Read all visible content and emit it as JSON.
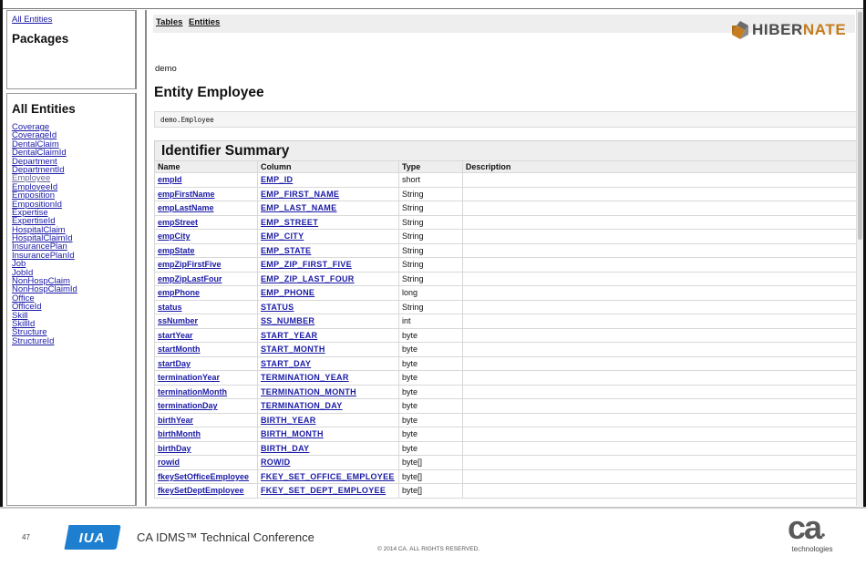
{
  "left_top": {
    "all_entities_link": "All Entities",
    "packages_title": "Packages"
  },
  "left_bottom": {
    "title": "All Entities",
    "items": [
      {
        "label": "Coverage",
        "current": false
      },
      {
        "label": "CoverageId",
        "current": false
      },
      {
        "label": "DentalClaim",
        "current": false
      },
      {
        "label": "DentalClaimId",
        "current": false
      },
      {
        "label": "Department",
        "current": false
      },
      {
        "label": "DepartmentId",
        "current": false
      },
      {
        "label": "Employee",
        "current": true
      },
      {
        "label": "EmployeeId",
        "current": false
      },
      {
        "label": "Emposition",
        "current": false
      },
      {
        "label": "EmpositionId",
        "current": false
      },
      {
        "label": "Expertise",
        "current": false
      },
      {
        "label": "ExpertiseId",
        "current": false
      },
      {
        "label": "HospitalClaim",
        "current": false
      },
      {
        "label": "HospitalClaimId",
        "current": false
      },
      {
        "label": "InsurancePlan",
        "current": false
      },
      {
        "label": "InsurancePlanId",
        "current": false
      },
      {
        "label": "Job",
        "current": false
      },
      {
        "label": "JobId",
        "current": false
      },
      {
        "label": "NonHospClaim",
        "current": false
      },
      {
        "label": "NonHospClaimId",
        "current": false
      },
      {
        "label": "Office",
        "current": false
      },
      {
        "label": "OfficeId",
        "current": false
      },
      {
        "label": "Skill",
        "current": false
      },
      {
        "label": "SkillId",
        "current": false
      },
      {
        "label": "Structure",
        "current": false
      },
      {
        "label": "StructureId",
        "current": false
      }
    ]
  },
  "nav": {
    "tables": "Tables",
    "entities": "Entities"
  },
  "logo": {
    "part1": "HIBER",
    "part2": "NATE"
  },
  "package_name": "demo",
  "entity_title": "Entity Employee",
  "qualified_name": "demo.Employee",
  "identifier_summary": {
    "title": "Identifier Summary",
    "columns": [
      "Name",
      "Column",
      "Type",
      "Description"
    ],
    "rows": [
      {
        "name": "empId",
        "column": "EMP_ID",
        "type": "short"
      },
      {
        "name": "empFirstName",
        "column": "EMP_FIRST_NAME",
        "type": "String"
      },
      {
        "name": "empLastName",
        "column": "EMP_LAST_NAME",
        "type": "String"
      },
      {
        "name": "empStreet",
        "column": "EMP_STREET",
        "type": "String"
      },
      {
        "name": "empCity",
        "column": "EMP_CITY",
        "type": "String"
      },
      {
        "name": "empState",
        "column": "EMP_STATE",
        "type": "String"
      },
      {
        "name": "empZipFirstFive",
        "column": "EMP_ZIP_FIRST_FIVE",
        "type": "String"
      },
      {
        "name": "empZipLastFour",
        "column": "EMP_ZIP_LAST_FOUR",
        "type": "String"
      },
      {
        "name": "empPhone",
        "column": "EMP_PHONE",
        "type": "long"
      },
      {
        "name": "status",
        "column": "STATUS",
        "type": "String"
      },
      {
        "name": "ssNumber",
        "column": "SS_NUMBER",
        "type": "int"
      },
      {
        "name": "startYear",
        "column": "START_YEAR",
        "type": "byte"
      },
      {
        "name": "startMonth",
        "column": "START_MONTH",
        "type": "byte"
      },
      {
        "name": "startDay",
        "column": "START_DAY",
        "type": "byte"
      },
      {
        "name": "terminationYear",
        "column": "TERMINATION_YEAR",
        "type": "byte"
      },
      {
        "name": "terminationMonth",
        "column": "TERMINATION_MONTH",
        "type": "byte"
      },
      {
        "name": "terminationDay",
        "column": "TERMINATION_DAY",
        "type": "byte"
      },
      {
        "name": "birthYear",
        "column": "BIRTH_YEAR",
        "type": "byte"
      },
      {
        "name": "birthMonth",
        "column": "BIRTH_MONTH",
        "type": "byte"
      },
      {
        "name": "birthDay",
        "column": "BIRTH_DAY",
        "type": "byte"
      },
      {
        "name": "rowid",
        "column": "ROWID",
        "type": "byte[]"
      },
      {
        "name": "fkeySetOfficeEmployee",
        "column": "FKEY_SET_OFFICE_EMPLOYEE",
        "type": "byte[]"
      },
      {
        "name": "fkeySetDeptEmployee",
        "column": "FKEY_SET_DEPT_EMPLOYEE",
        "type": "byte[]"
      }
    ]
  },
  "footer": {
    "slide_number": "47",
    "iua_logo_text": "IUA",
    "conference": "CA IDMS™ Technical Conference",
    "copyright": "© 2014 CA. ALL RIGHTS RESERVED.",
    "ca_logo_text": "ca",
    "ca_logo_sub": "technologies"
  },
  "colors": {
    "link": "#1a1aa6",
    "hibernate_orange": "#c57d1f",
    "iua_blue": "#1e7fd0"
  }
}
